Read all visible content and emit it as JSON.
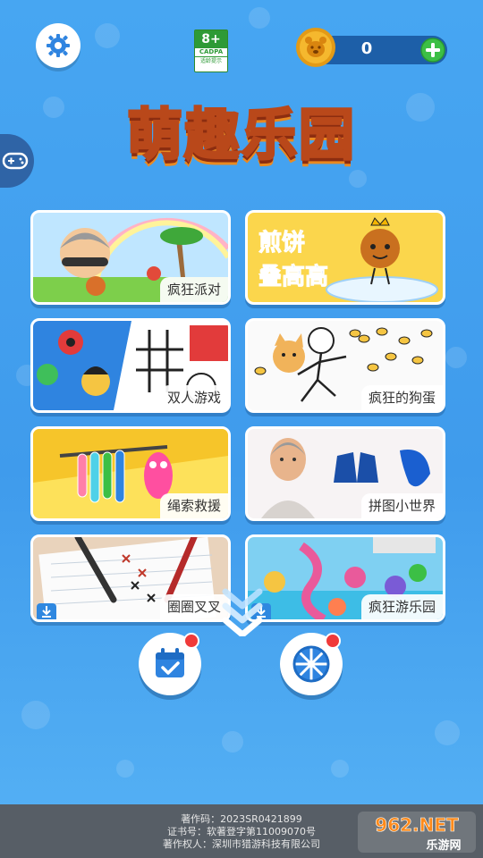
{
  "header": {
    "age_rating": "8+",
    "age_org": "CADPA",
    "age_caption": "适龄提示",
    "coin_count": "0"
  },
  "logo_text": "萌趣乐园",
  "games": [
    {
      "label": "疯狂派对",
      "download": false
    },
    {
      "label": "煎饼叠高高",
      "download": false,
      "art_line1": "煎饼",
      "art_line2": "叠高高"
    },
    {
      "label": "双人游戏",
      "download": false
    },
    {
      "label": "疯狂的狗蛋",
      "download": false
    },
    {
      "label": "绳索救援",
      "download": false
    },
    {
      "label": "拼图小世界",
      "download": false
    },
    {
      "label": "圈圈叉叉",
      "download": true
    },
    {
      "label": "疯狂游乐园",
      "download": true
    }
  ],
  "footer": {
    "line1": "著作码：2023SR0421899",
    "line2": "证书号：软著登字第11009070号",
    "line3": "著作权人：深圳市猎游科技有限公司"
  },
  "watermark": {
    "top": "962.NET",
    "bottom": "乐游网"
  },
  "colors": {
    "background": "#47a6f2",
    "accent_red": "#f03a3a",
    "coin": "#f5b82e",
    "plus": "#3cbf45"
  },
  "icons": [
    "gear-icon",
    "coin-icon",
    "plus-icon",
    "gamepad-icon",
    "chevron-down-icon",
    "calendar-icon",
    "wheel-icon",
    "download-icon"
  ]
}
